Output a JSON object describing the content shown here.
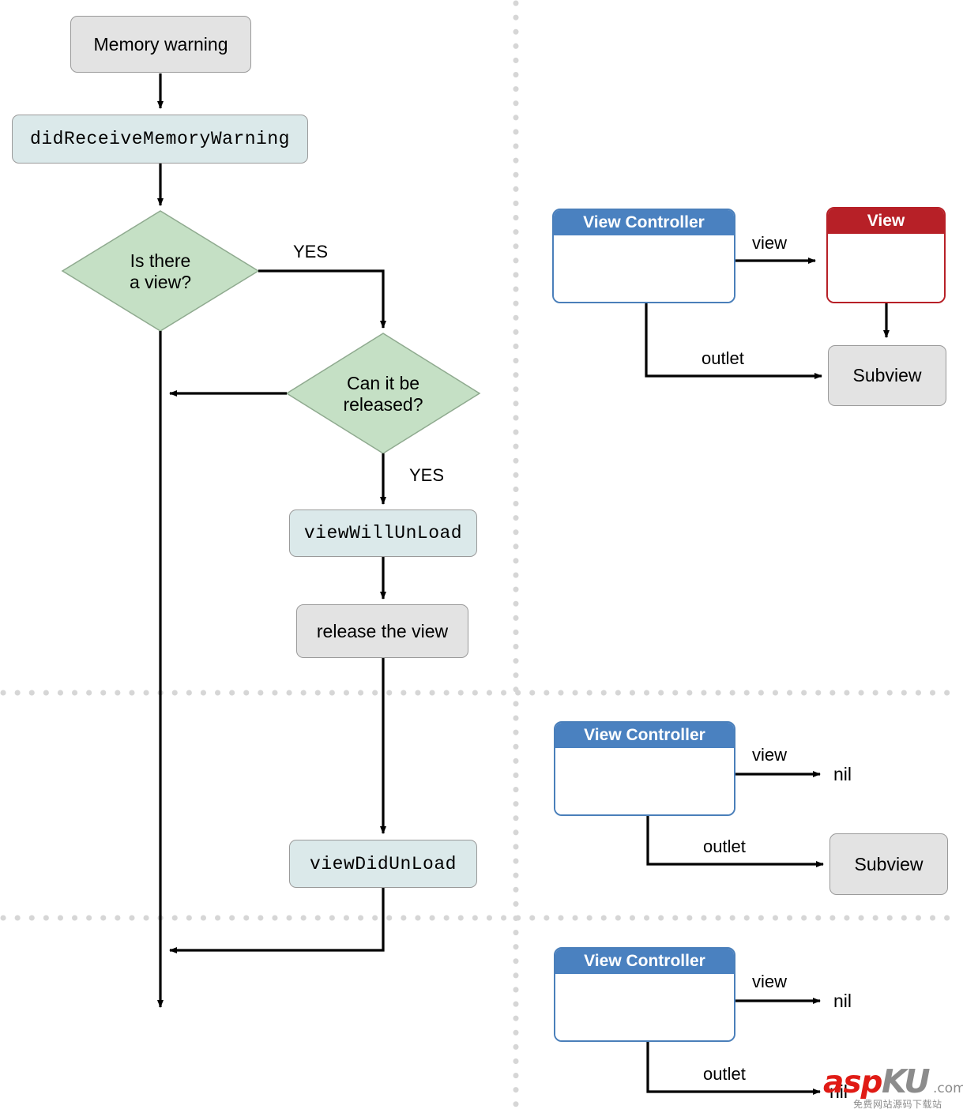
{
  "diagram": {
    "title": "iOS View Controller memory warning lifecycle",
    "colors": {
      "gray_fill": "#e3e3e3",
      "gray_stroke": "#9a9a9a",
      "code_fill": "#dbe9ea",
      "green_fill": "#c5e0c5",
      "green_stroke": "#8faa8f",
      "blue_header": "#4a81c0",
      "blue_border": "#4a7fba",
      "red_header": "#b72027",
      "red_border": "#b72027",
      "arrow": "#000000",
      "divider_dot": "#d6d6d6",
      "watermark_red": "#e01b15",
      "watermark_gray": "#8c8c8c"
    }
  },
  "flowchart": {
    "nodes": [
      {
        "id": "memory-warning",
        "label": "Memory warning",
        "shape": "rounded-rect",
        "style": "gray"
      },
      {
        "id": "did-receive-memory",
        "label": "didReceiveMemoryWarning",
        "shape": "rounded-rect",
        "style": "code"
      },
      {
        "id": "is-there-a-view",
        "label": "Is there\na view?",
        "shape": "diamond",
        "style": "green"
      },
      {
        "id": "can-it-be-released",
        "label": "Can it be\nreleased?",
        "shape": "diamond",
        "style": "green"
      },
      {
        "id": "view-will-unload",
        "label": "viewWillUnLoad",
        "shape": "rounded-rect",
        "style": "code"
      },
      {
        "id": "release-the-view",
        "label": "release the view",
        "shape": "rounded-rect",
        "style": "gray"
      },
      {
        "id": "view-did-unload",
        "label": "viewDidUnLoad",
        "shape": "rounded-rect",
        "style": "code"
      }
    ],
    "node_labels": {
      "memory_warning": "Memory warning",
      "did_receive_memory_warning": "didReceiveMemoryWarning",
      "is_there_a_view_line1": "Is there",
      "is_there_a_view_line2": "a view?",
      "can_it_be_released_line1": "Can it be",
      "can_it_be_released_line2": "released?",
      "view_will_unload": "viewWillUnLoad",
      "release_the_view": "release the view",
      "view_did_unload": "viewDidUnLoad"
    },
    "edge_labels": {
      "yes_is_there_a_view": "YES",
      "yes_can_it_be_released": "YES"
    }
  },
  "panels": [
    {
      "id": "panel-top",
      "view_controller_title": "View Controller",
      "view_title": "View",
      "subview_title": "Subview",
      "view_edge_label": "view",
      "outlet_edge_label": "outlet",
      "view_target": "View",
      "outlet_target": "Subview"
    },
    {
      "id": "panel-middle",
      "view_controller_title": "View Controller",
      "subview_title": "Subview",
      "view_edge_label": "view",
      "outlet_edge_label": "outlet",
      "view_target": "nil",
      "outlet_target": "Subview"
    },
    {
      "id": "panel-bottom",
      "view_controller_title": "View Controller",
      "view_edge_label": "view",
      "outlet_edge_label": "outlet",
      "view_target": "nil",
      "outlet_target": "nil"
    }
  ],
  "watermark": {
    "brand_primary": "asp",
    "brand_secondary": "KU",
    "domain_suffix": ".com",
    "tagline": "免费网站源码下载站"
  }
}
